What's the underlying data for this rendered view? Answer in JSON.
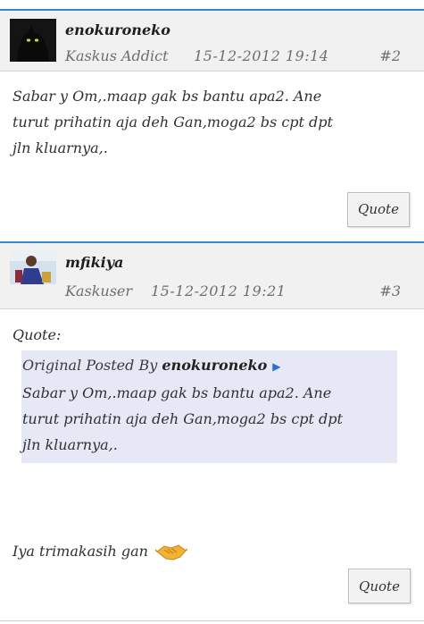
{
  "posts": [
    {
      "username": "enokuroneko",
      "rank": "Kaskus Addict",
      "date": "15-12-2012 19:14",
      "post_number": "#2",
      "body_lines": [
        "Sabar y Om,.maap  gak bs bantu apa2. Ane",
        "turut prihatin aja deh Gan,moga2  bs cpt dpt",
        "jln kluarnya,."
      ],
      "quote_button": "Quote"
    },
    {
      "username": "mfikiya",
      "rank": "Kaskuser",
      "date": "15-12-2012 19:21",
      "post_number": "#3",
      "quote_label": "Quote:",
      "quote": {
        "prefix": "Original Posted By",
        "author": "enokuroneko",
        "lines": [
          "Sabar y Om,.maap  gak bs bantu apa2. Ane",
          "turut prihatin aja deh Gan,moga2  bs cpt dpt",
          "jln kluarnya,."
        ]
      },
      "reply": "Iya trimakasih  gan",
      "quote_button": "Quote"
    }
  ],
  "icons": {
    "avatar1": "black-cat-avatar",
    "avatar2": "user-photo-avatar",
    "arrow": "view-post-arrow-icon",
    "emoticon": "handshake-icon"
  },
  "colors": {
    "header_border": "#3a86c8",
    "quote_bg": "#e6e9f5",
    "arrow": "#2c6fd6"
  }
}
